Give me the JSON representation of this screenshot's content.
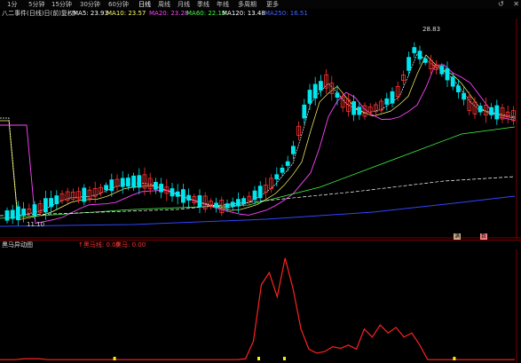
{
  "tabs": [
    "1分",
    "5分钟",
    "15分钟",
    "30分钟",
    "60分钟",
    "日线",
    "周线",
    "月线",
    "季线",
    "年线",
    "多周期",
    "更多"
  ],
  "toolbar_icons": [
    "↺",
    "✕"
  ],
  "infobar": {
    "title": "八二事件(日线)日(前)复权)",
    "ma5": "MA5: 23.93",
    "ma10": "MA10: 23.57",
    "ma20": "MA20: 23.28",
    "ma60": "MA60: 22.15",
    "ma120": "MA120: 13.48",
    "ma250": "MA250: 16.51",
    "colors": {
      "ma5": "#ffffff",
      "ma10": "#ffff66",
      "ma20": "#ff44ff",
      "ma60": "#44ff44",
      "ma120": "#ffffff",
      "ma250": "#4466ff"
    }
  },
  "price_labels": {
    "high": "28.83",
    "low": "11.10"
  },
  "badges": [
    {
      "text": "满",
      "color": "#d2b48c"
    },
    {
      "text": "数",
      "color": "#ff8888"
    }
  ],
  "indicator": {
    "name": "黑马异动图",
    "line1_label": "↑黑马线: 0.00",
    "line2_label": "黑马: 0.00"
  },
  "indicator_series": [
    2,
    2,
    2,
    3,
    3,
    3,
    2,
    2,
    2,
    2,
    2,
    2,
    2,
    2,
    2,
    2,
    2,
    2,
    2,
    2,
    2,
    2,
    2,
    2,
    2,
    2,
    2,
    2,
    2,
    2,
    2,
    3,
    25,
    95,
    110,
    80,
    128,
    90,
    40,
    15,
    10,
    12,
    18,
    16,
    20,
    15,
    40,
    30,
    45,
    35,
    42,
    30,
    35,
    20,
    2,
    2,
    2,
    2,
    2,
    2,
    2,
    2,
    2,
    2,
    2,
    2
  ],
  "indicator_marks": [
    0.22,
    0.5,
    0.55,
    0.88
  ]
}
